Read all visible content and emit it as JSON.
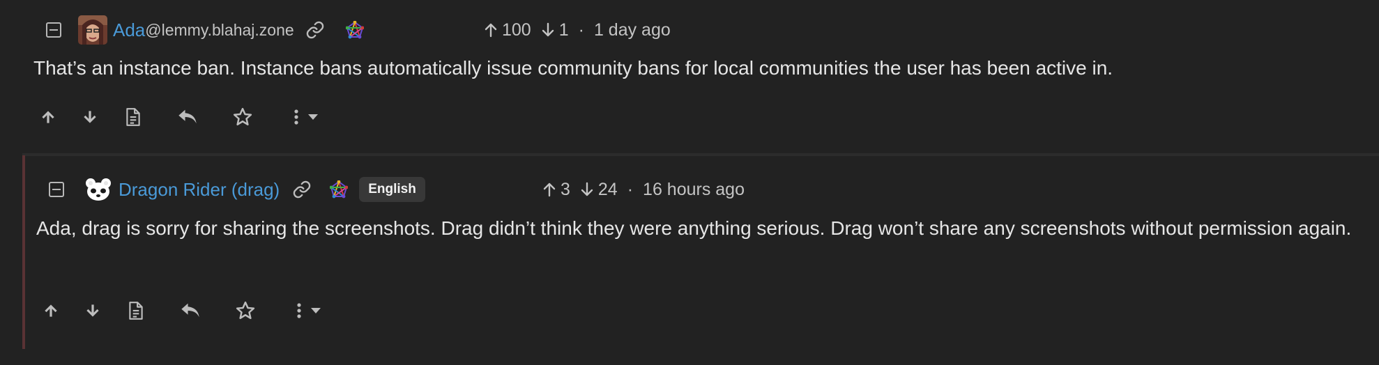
{
  "comments": [
    {
      "author": "Ada",
      "instance": "@lemmy.blahaj.zone",
      "language": "",
      "upvotes": "100",
      "downvotes": "1",
      "separator": "·",
      "time": "1 day ago",
      "body": "That’s an instance ban. Instance bans automatically issue community bans for local communities the user has been active in.",
      "icons": [
        "collapse-icon",
        "avatar",
        "link-icon",
        "fediverse-icon",
        "arrow-up-icon",
        "arrow-down-icon",
        "upvote-icon",
        "downvote-icon",
        "view-source-icon",
        "reply-icon",
        "star-icon",
        "more-vertical-icon",
        "chevron-down-icon"
      ]
    },
    {
      "author": "Dragon Rider (drag)",
      "instance": "",
      "language": "English",
      "upvotes": "3",
      "downvotes": "24",
      "separator": "·",
      "time": "16 hours ago",
      "body": "Ada, drag is sorry for sharing the screenshots. Drag didn’t think they were anything serious. Drag won’t share any screenshots without permission again.",
      "icons": [
        "collapse-icon",
        "avatar",
        "link-icon",
        "fediverse-icon",
        "arrow-up-icon",
        "arrow-down-icon",
        "upvote-icon",
        "downvote-icon",
        "view-source-icon",
        "reply-icon",
        "star-icon",
        "more-vertical-icon",
        "chevron-down-icon"
      ]
    }
  ],
  "colors": {
    "background": "#222222",
    "username": "#4a9ad8",
    "text": "#e6e6e6",
    "muted": "#c4c4c4",
    "thread_line": "#5a3234",
    "badge_bg": "#383838"
  }
}
